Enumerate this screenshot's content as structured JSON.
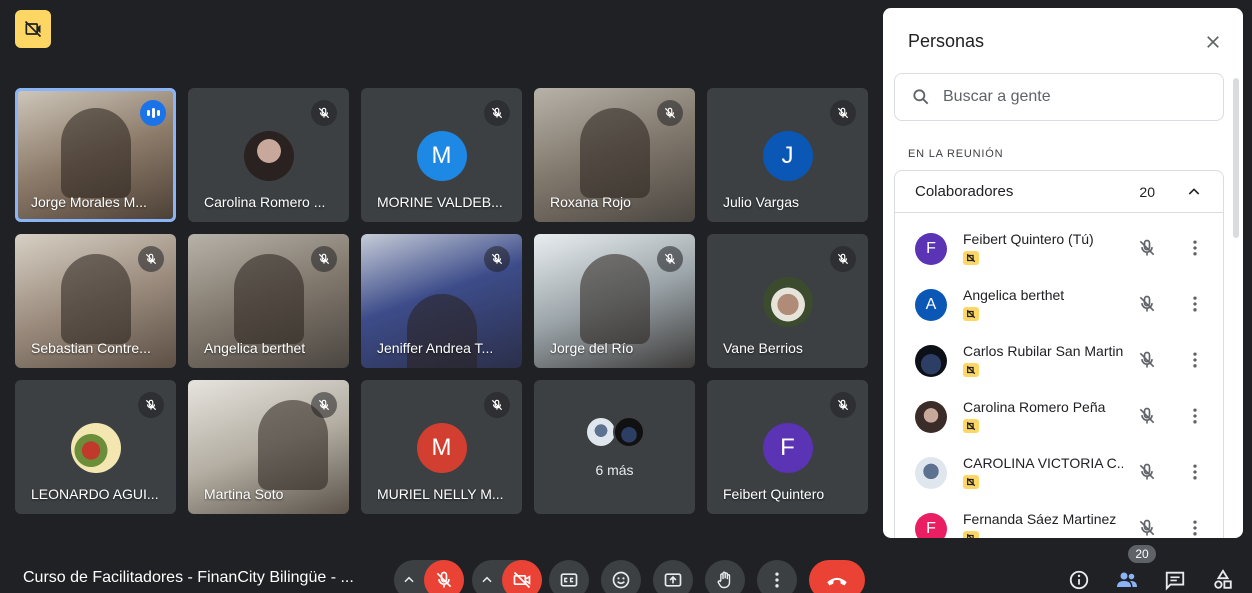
{
  "colors": {
    "background": "#202124",
    "tile": "#3c4043",
    "accent_blue": "#8ab4f8",
    "danger_red": "#ea4335",
    "recording_yellow": "#fdd663"
  },
  "recording_icon": "recording-badge-icon",
  "tiles": [
    {
      "name": "Jorge Morales M...",
      "type": "video",
      "speaking": true
    },
    {
      "name": "Carolina Romero ...",
      "type": "photo-avatar",
      "muted": true
    },
    {
      "name": "MORINE VALDEB...",
      "type": "letter",
      "letter": "M",
      "color": "#1e88e5",
      "muted": true
    },
    {
      "name": "Roxana Rojo",
      "type": "video",
      "muted": true
    },
    {
      "name": "Julio Vargas",
      "type": "letter",
      "letter": "J",
      "color": "#0b57b5",
      "muted": true
    },
    {
      "name": "Sebastian Contre...",
      "type": "video",
      "muted": true
    },
    {
      "name": "Angelica berthet",
      "type": "video",
      "muted": true
    },
    {
      "name": "Jeniffer Andrea T...",
      "type": "video",
      "muted": true
    },
    {
      "name": "Jorge del Río",
      "type": "video",
      "muted": true
    },
    {
      "name": "Vane Berrios",
      "type": "photo-avatar",
      "muted": true
    },
    {
      "name": "LEONARDO AGUI...",
      "type": "photo-avatar",
      "muted": true
    },
    {
      "name": "Martina Soto",
      "type": "video",
      "muted": true
    },
    {
      "name": "MURIEL NELLY M...",
      "type": "letter",
      "letter": "M",
      "color": "#d23f31",
      "muted": true
    },
    {
      "label": "6 más",
      "type": "more"
    },
    {
      "name": "Feibert Quintero",
      "type": "letter",
      "letter": "F",
      "color": "#5b33b5",
      "muted": true
    }
  ],
  "panel": {
    "title": "Personas",
    "search_placeholder": "Buscar a gente",
    "section_label": "EN LA REUNIÓN",
    "group": {
      "label": "Colaboradores",
      "count": "20"
    },
    "participants": [
      {
        "name": "Feibert Quintero (Tú)",
        "letter": "F",
        "color": "#5b33b5"
      },
      {
        "name": "Angelica berthet",
        "letter": "A",
        "color": "#0b57b5"
      },
      {
        "name": "Carlos Rubilar San Martin",
        "letter": "",
        "color": "#1b2a3a"
      },
      {
        "name": "Carolina Romero Peña",
        "letter": "",
        "color": "#6d4c41"
      },
      {
        "name": "CAROLINA VICTORIA C...",
        "letter": "",
        "color": "#5d7290"
      },
      {
        "name": "Fernanda Sáez Martinez",
        "letter": "F",
        "color": "#e91e63"
      }
    ]
  },
  "bottom_bar": {
    "meeting_title": "Curso de Facilitadores - FinanCity Bilingüe - ...",
    "people_count": "20"
  }
}
